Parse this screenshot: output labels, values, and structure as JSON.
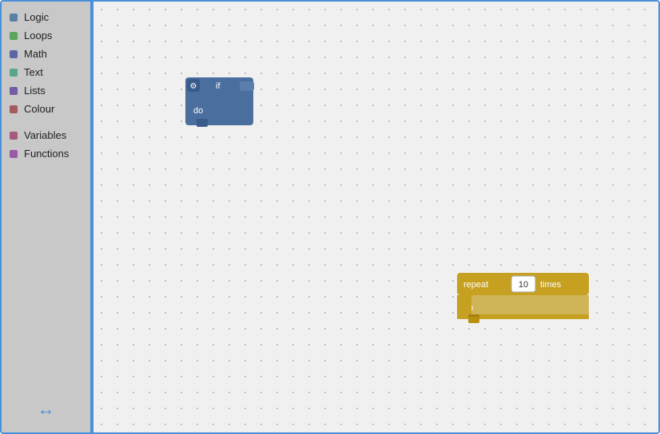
{
  "sidebar": {
    "items": [
      {
        "label": "Logic",
        "color": "#5b80a5"
      },
      {
        "label": "Loops",
        "color": "#5ba55b"
      },
      {
        "label": "Math",
        "color": "#5b67a5"
      },
      {
        "label": "Text",
        "color": "#5ba58c"
      },
      {
        "label": "Lists",
        "color": "#745ba5"
      },
      {
        "label": "Colour",
        "color": "#a55b5b"
      }
    ],
    "items2": [
      {
        "label": "Variables",
        "color": "#a55b80"
      },
      {
        "label": "Functions",
        "color": "#995ba5"
      }
    ]
  },
  "blocks": {
    "if_block": {
      "label_if": "if",
      "label_do": "do"
    },
    "repeat_block": {
      "label_repeat": "repeat",
      "label_value": "10",
      "label_times": "times",
      "label_do": "do"
    }
  },
  "resize_arrow": "↔"
}
